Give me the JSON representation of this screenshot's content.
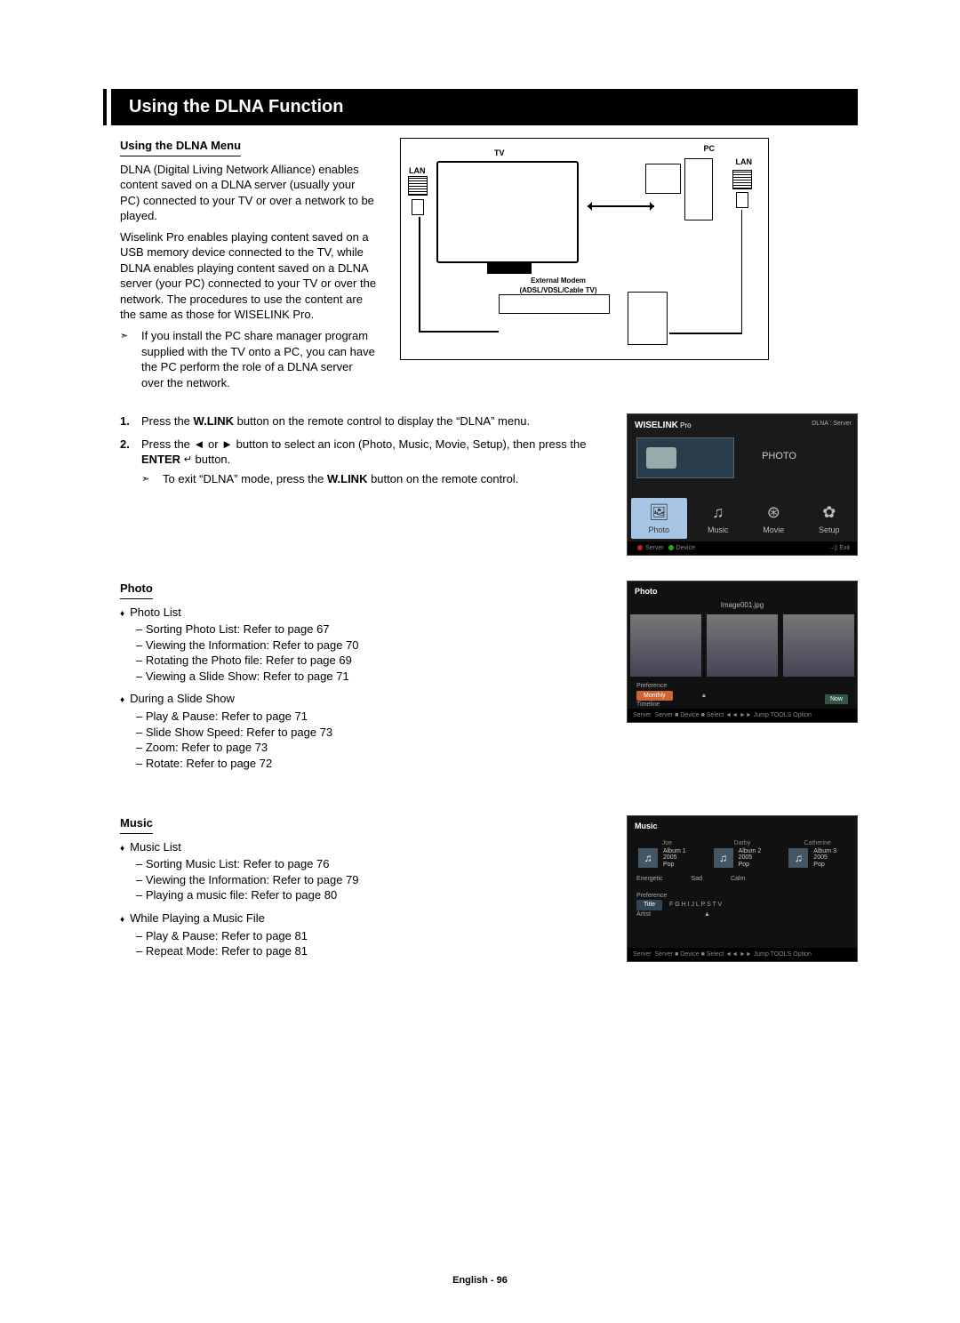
{
  "page": {
    "title": "Using the DLNA Function",
    "subhead": "Using the DLNA Menu",
    "intro1": "DLNA (Digital Living Network Alliance) enables content saved on a DLNA server (usually your PC) connected to your TV or over a network to be played.",
    "intro2": "Wiselink Pro enables playing content saved on a USB memory device connected to the TV, while DLNA enables playing content saved on a DLNA server (your PC) connected to your TV or over the network. The procedures to use the content are the same as those for WISELINK Pro.",
    "note1": "If you install the PC share manager program supplied with the TV onto a PC, you can have the PC perform the role of a DLNA server over the network.",
    "step1a": "Press the ",
    "step1b": "W.LINK",
    "step1c": " button on the remote control to display the “DLNA” menu.",
    "step2a": "Press the ◄ or ► button to select an icon (Photo, Music, Movie, Setup), then press the ",
    "step2b": "ENTER",
    "step2c": " button.",
    "step2note": "To exit “DLNA” mode, press the ",
    "step2note_b": "W.LINK",
    "step2note_c": " button on the remote control.",
    "photo_h": "Photo",
    "photo_list_h": "Photo List",
    "photo_list": [
      "Sorting Photo List: Refer to page 67",
      "Viewing the Information: Refer to page 70",
      "Rotating the Photo file: Refer to page 69",
      "Viewing a Slide Show: Refer to page 71"
    ],
    "slide_h": "During a Slide Show",
    "slide_list": [
      "Play & Pause: Refer to page 71",
      "Slide Show Speed: Refer to page 73",
      "Zoom: Refer to page 73",
      "Rotate: Refer to page 72"
    ],
    "music_h": "Music",
    "music_list_h": "Music List",
    "music_list": [
      "Sorting Music List: Refer to page 76",
      "Viewing the Information: Refer to page 79",
      "Playing a music file: Refer to page 80"
    ],
    "music_play_h": "While Playing a Music File",
    "music_play_list": [
      "Play & Pause: Refer to page 81",
      "Repeat Mode: Refer to page 81"
    ]
  },
  "diagram": {
    "tv": "TV",
    "pc": "PC",
    "lan": "LAN",
    "modem1": "External Modem",
    "modem2": "(ADSL/VDSL/Cable TV)"
  },
  "panel_wiselink": {
    "brand": "WISELINK",
    "brand_sub": " Pro",
    "dlna": "DLNA : Server",
    "sel_label": "PHOTO",
    "icons": [
      {
        "glyph": "🖼",
        "label": "Photo"
      },
      {
        "glyph": "♫",
        "label": "Music"
      },
      {
        "glyph": "⊛",
        "label": "Movie"
      },
      {
        "glyph": "✿",
        "label": "Setup"
      }
    ],
    "footer_server": "Server",
    "footer_device": "Device",
    "footer_exit": "Exit"
  },
  "panel_photo": {
    "title": "Photo",
    "filename": "Image001.jpg",
    "pref": "Preference",
    "cat1": "Monthly",
    "cat2": "Timeline",
    "now": "Now",
    "footer": "Server  ■ Device  ■ Select  ◄◄ ►► Jump  TOOLS Option"
  },
  "panel_music": {
    "title": "Music",
    "items": [
      {
        "name": "Joe",
        "album": "Album 1",
        "year": "2005",
        "genre": "Pop"
      },
      {
        "name": "Darby",
        "album": "Album 2",
        "year": "2005",
        "genre": "Pop"
      },
      {
        "name": "Catherine",
        "album": "Album 3",
        "year": "2005",
        "genre": "Pop"
      }
    ],
    "cat1": "Energetic",
    "cat2": "Sad",
    "cat3": "Calm",
    "pref": "Preference",
    "row_title": "Title",
    "row_artist": "Artist",
    "alpha": "F  G  H  I  J  L  P  S  T  V",
    "footer": "Server  ■ Device  ■ Select  ◄◄ ►► Jump  TOOLS Option"
  },
  "footer": {
    "lang": "English - ",
    "page": "96"
  }
}
